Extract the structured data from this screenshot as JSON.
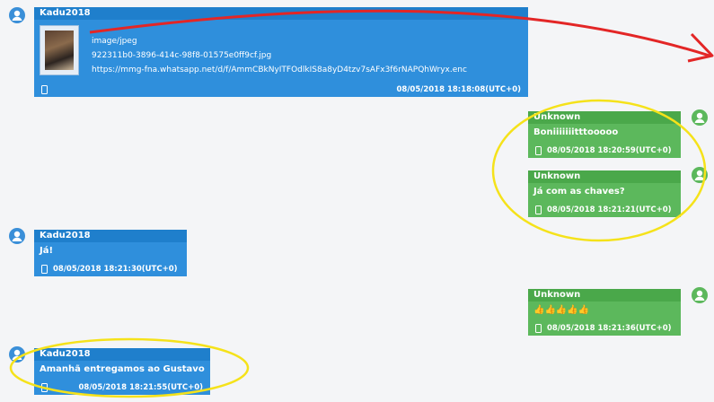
{
  "messages": [
    {
      "sender": "Kadu2018",
      "attachment": {
        "mime": "image/jpeg",
        "filename": "922311b0-3896-414c-98f8-01575e0ff9cf.jpg",
        "url": "https://mmg-fna.whatsapp.net/d/f/AmmCBkNyITFOdlkIS8a8yD4tzv7sAFx3f6rNAPQhWryx.enc"
      },
      "timestamp": "08/05/2018 18:18:08(UTC+0)"
    },
    {
      "sender": "Unknown",
      "text": "Boniiiiiiitttooooo",
      "timestamp": "08/05/2018 18:20:59(UTC+0)"
    },
    {
      "sender": "Unknown",
      "text": "Já com as chaves?",
      "timestamp": "08/05/2018 18:21:21(UTC+0)"
    },
    {
      "sender": "Kadu2018",
      "text": "Já!",
      "timestamp": "08/05/2018 18:21:30(UTC+0)"
    },
    {
      "sender": "Unknown",
      "text": "👍👍👍👍👍",
      "timestamp": "08/05/2018 18:21:36(UTC+0)"
    },
    {
      "sender": "Kadu2018",
      "text": "Amanhã entregamos ao Gustavo",
      "timestamp": "08/05/2018 18:21:55(UTC+0)"
    }
  ],
  "colors": {
    "outgoing": "#2f8fdc",
    "incoming": "#5cb85c",
    "arrow": "#e32626",
    "highlight": "#f5e21a"
  }
}
